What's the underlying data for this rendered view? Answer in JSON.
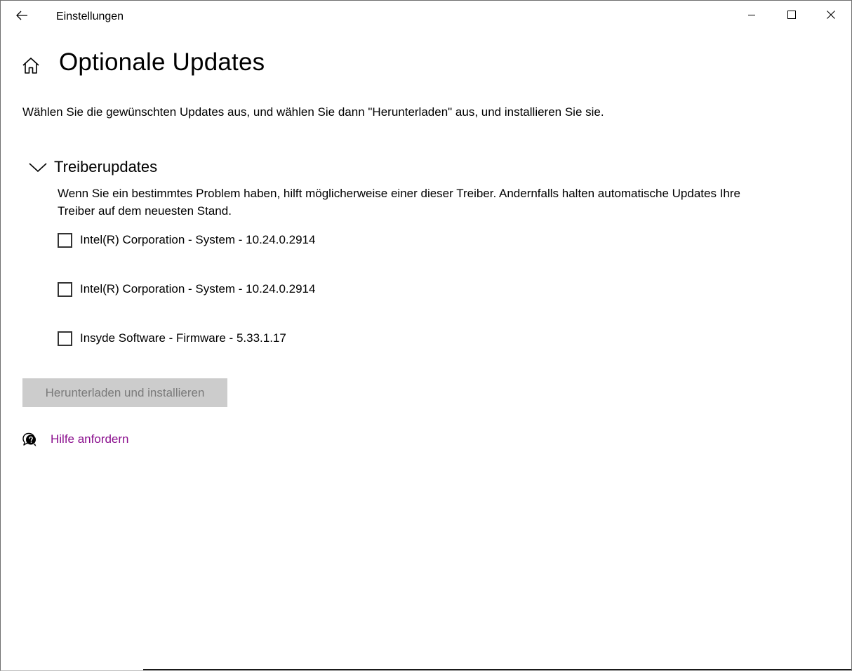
{
  "window": {
    "title": "Einstellungen",
    "icons": {
      "back": "arrow-left-icon",
      "minimize": "minimize-icon",
      "maximize": "maximize-icon",
      "close": "close-icon"
    }
  },
  "header": {
    "home_icon": "home-icon",
    "title": "Optionale Updates"
  },
  "intro": "Wählen Sie die gewünschten Updates aus, und wählen Sie dann \"Herunterladen\" aus, und installieren Sie sie.",
  "section": {
    "icon": "chevron-down-icon",
    "title": "Treiberupdates",
    "description": "Wenn Sie ein bestimmtes Problem haben, hilft möglicherweise einer dieser Treiber. Andernfalls halten automatische Updates Ihre Treiber auf dem neuesten Stand.",
    "items": [
      {
        "label": "Intel(R) Corporation - System - 10.24.0.2914",
        "checked": false
      },
      {
        "label": "Intel(R) Corporation - System - 10.24.0.2914",
        "checked": false
      },
      {
        "label": "Insyde Software - Firmware - 5.33.1.17",
        "checked": false
      }
    ]
  },
  "actions": {
    "download_label": "Herunterladen und installieren",
    "download_enabled": false
  },
  "help": {
    "icon": "help-chat-icon",
    "label": "Hilfe anfordern"
  },
  "colors": {
    "link": "#8a0e8d",
    "button_disabled_bg": "#cccccc",
    "button_disabled_text": "#7a7a7a"
  }
}
